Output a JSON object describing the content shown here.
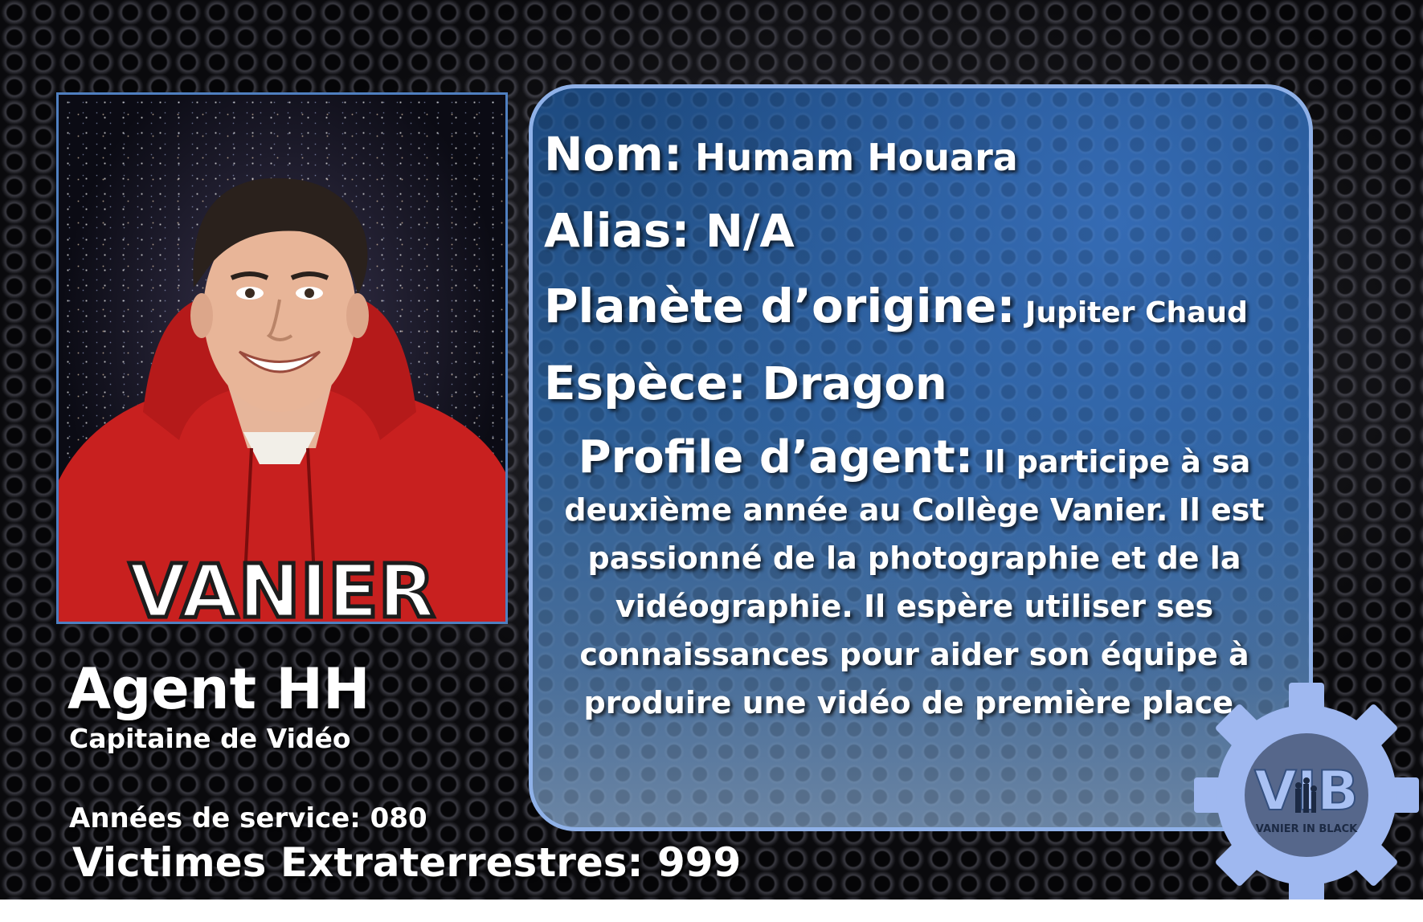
{
  "agent": {
    "name": "Agent HH",
    "role": "Capitaine de Vidéo",
    "years_label": "Années de service: 080",
    "victims_label": "Victimes Extraterrestres: 999"
  },
  "info": {
    "nom_label": "Nom:",
    "nom_value": " Humam Houara",
    "alias_label": "Alias:",
    "alias_value": " N/A",
    "planete_label": "Planète d’origine:",
    "planete_value": " Jupiter Chaud",
    "espece_label": "Espèce:",
    "espece_value": " Dragon",
    "profile_label": "Profile d’agent:",
    "profile_value": " Il participe à sa deuxième année au Collège Vanier. Il est passionné de la photographie et de la vidéographie. Il espère utiliser ses connaissances pour aider son équipe à produire une vidéo de première place."
  },
  "photo": {
    "sweater_text": "VANIER"
  },
  "logo": {
    "letters": "VIB",
    "tagline": "VANIER IN BLACK"
  },
  "colors": {
    "panel_border": "#8fb1e8",
    "panel_blue": "#2c5e97",
    "photo_border": "#4f7fc0",
    "gear": "#9fb8f0",
    "sweater_red": "#c8201f"
  },
  "icons": {
    "logo": "gear-logo-icon"
  }
}
